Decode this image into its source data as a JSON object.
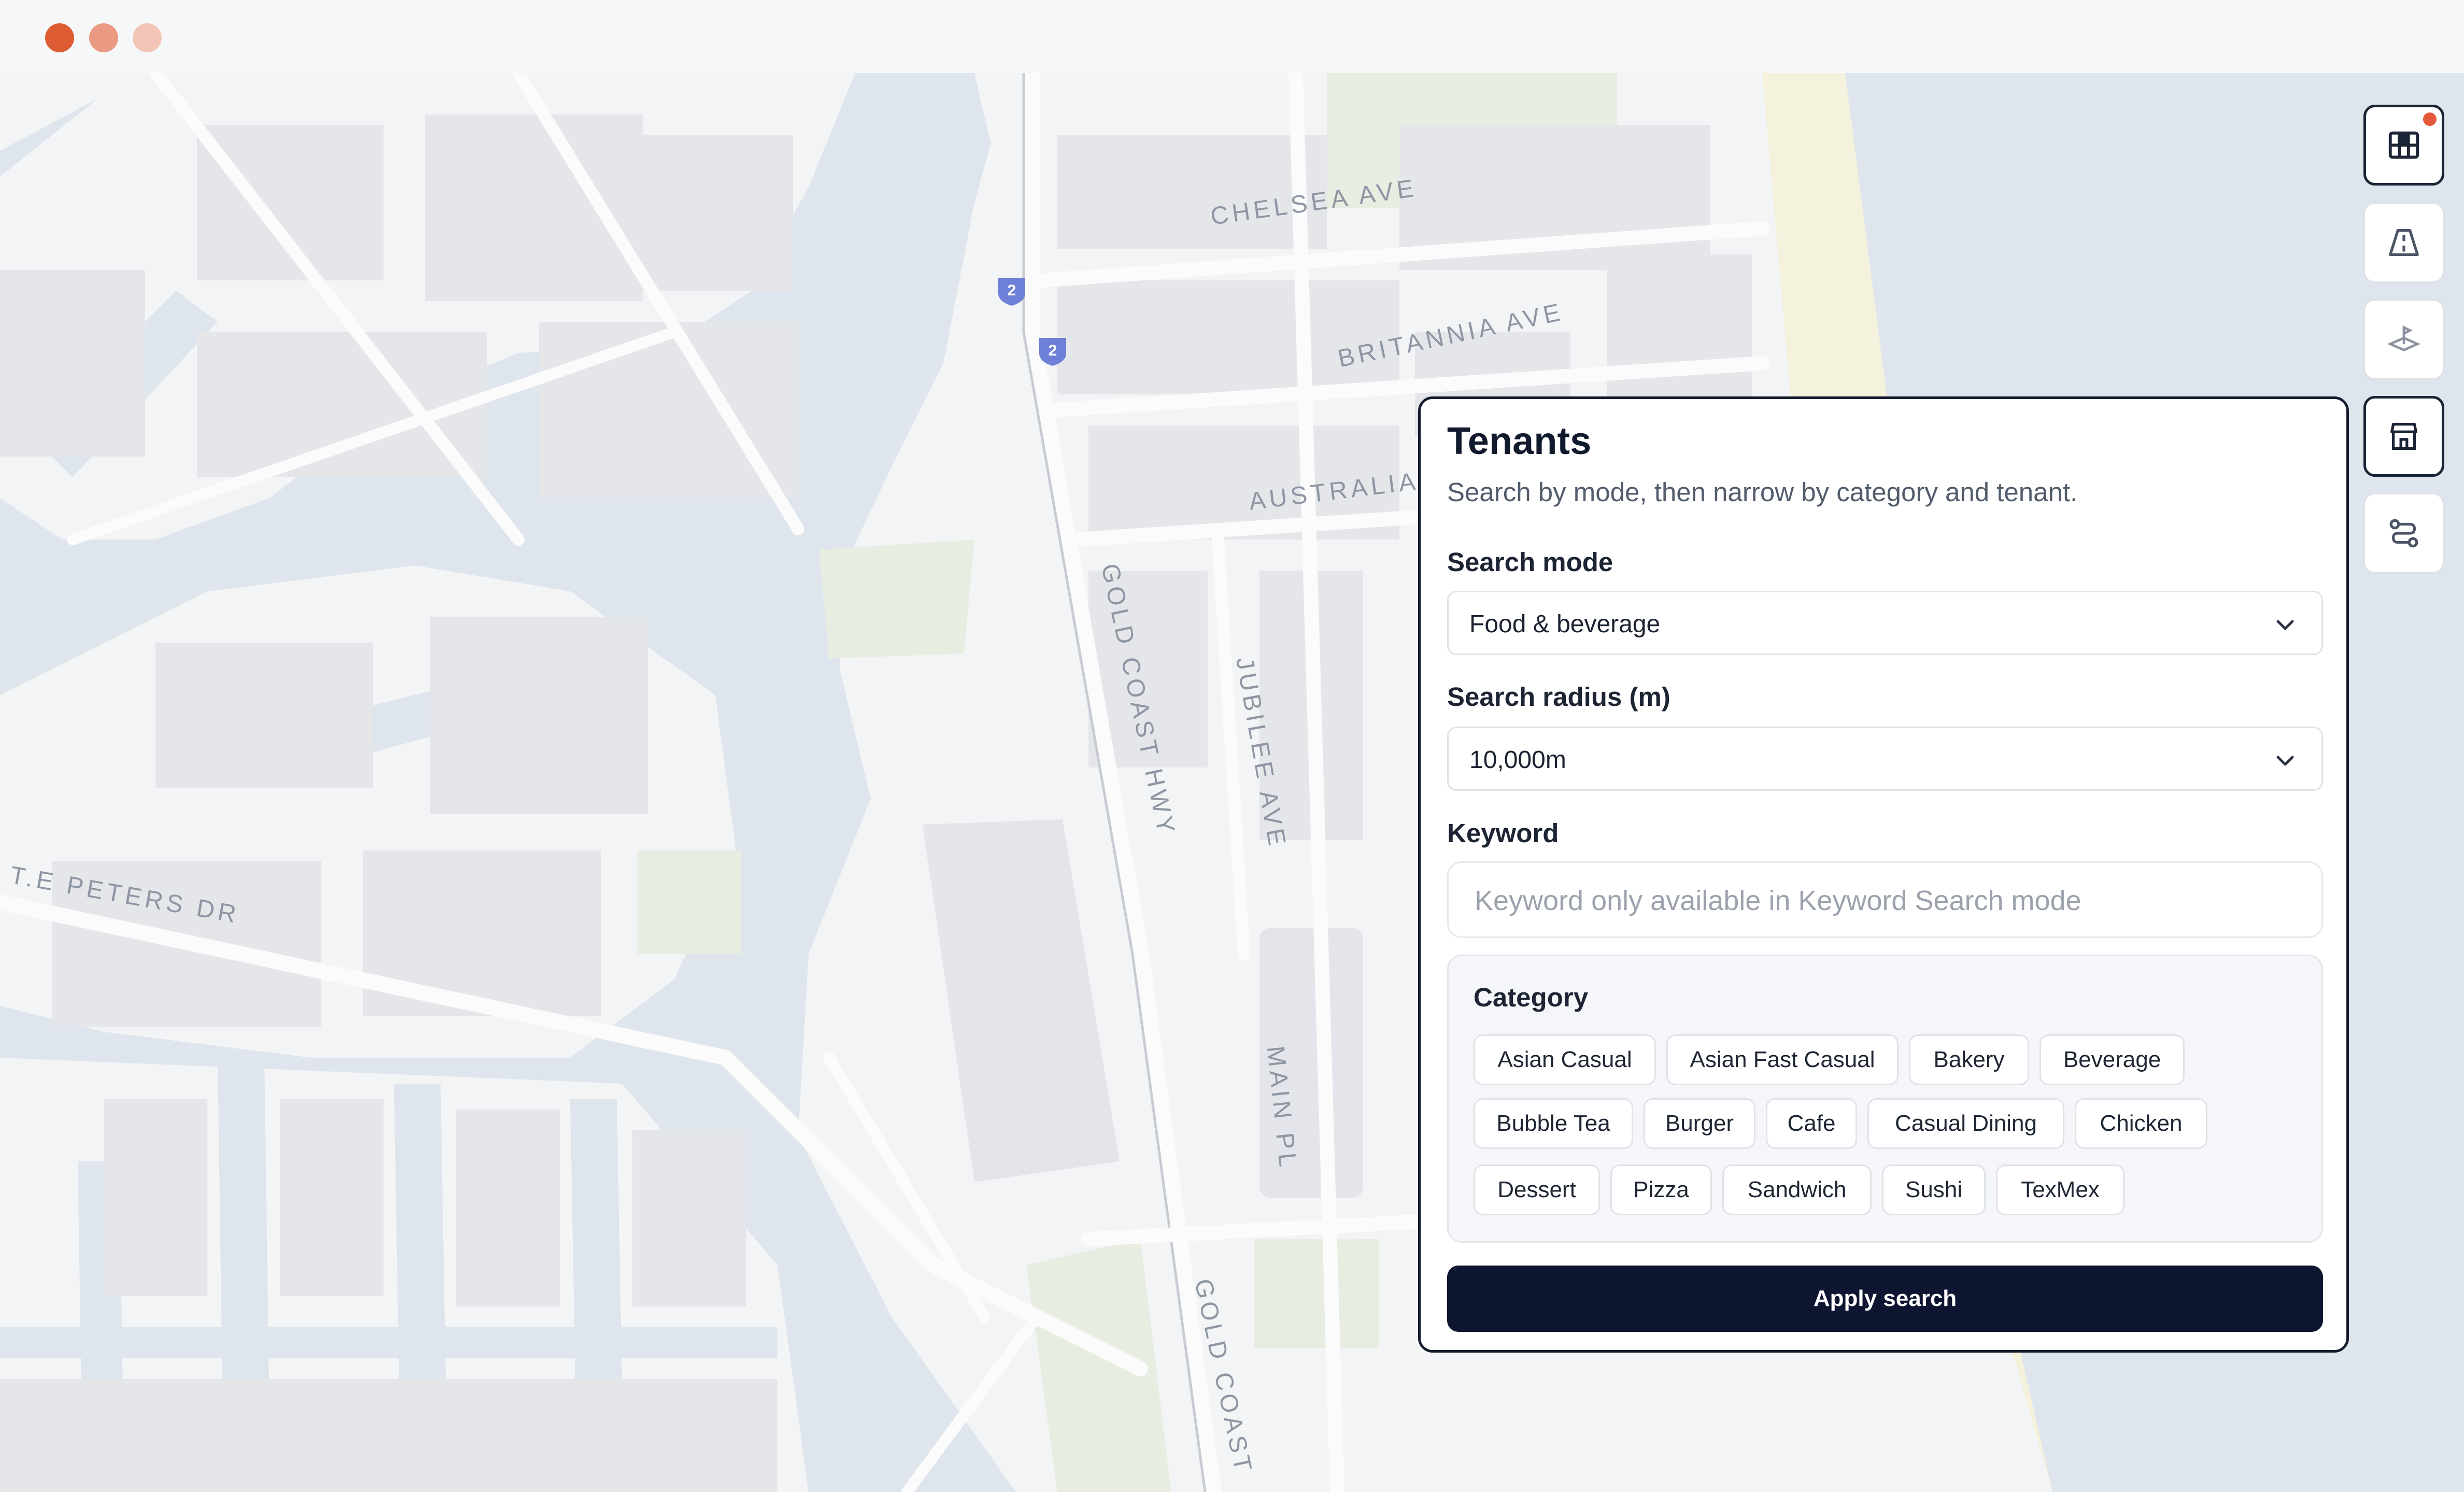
{
  "window": {
    "controls": [
      {
        "name": "close",
        "color": "#dd5c33"
      },
      {
        "name": "minimize",
        "color": "#ea9a82"
      },
      {
        "name": "maximize",
        "color": "#f2c5b6"
      }
    ]
  },
  "map": {
    "streets": [
      "CHELSEA AVE",
      "BRITANNIA AVE",
      "AUSTRALIA",
      "GOLD COAST HWY",
      "JUBILEE AVE",
      "T.E PETERS DR",
      "MAIN PL",
      "GOLD COAST"
    ],
    "route_shield": "2",
    "colors": {
      "water": "#dfe5ec",
      "land": "#f3f4f6",
      "road": "#fbfbfc",
      "park": "#e8ede1",
      "beach": "#f4f1dc",
      "building": "#e3e5ea"
    }
  },
  "toolbar": {
    "items": [
      {
        "icon": "grid-layers-icon",
        "active": true,
        "notification": true
      },
      {
        "icon": "road-icon",
        "active": false
      },
      {
        "icon": "location-pin-plane-icon",
        "active": false
      },
      {
        "icon": "storefront-icon",
        "active": true
      },
      {
        "icon": "route-path-icon",
        "active": false
      }
    ]
  },
  "panel": {
    "title": "Tenants",
    "subtitle": "Search by mode, then narrow by category and tenant.",
    "search_mode": {
      "label": "Search mode",
      "value": "Food & beverage"
    },
    "search_radius": {
      "label": "Search radius (m)",
      "value": "10,000m"
    },
    "keyword": {
      "label": "Keyword",
      "placeholder": "Keyword only available in Keyword Search mode"
    },
    "category": {
      "label": "Category",
      "rows": [
        [
          "Asian Casual",
          "Asian Fast Casual",
          "Bakery",
          "Beverage"
        ],
        [
          "Bubble Tea",
          "Burger",
          "Cafe",
          "Casual Dining",
          "Chicken"
        ],
        [
          "Dessert",
          "Pizza",
          "Sandwich",
          "Sushi",
          "TexMex"
        ]
      ]
    },
    "apply_label": "Apply search"
  }
}
